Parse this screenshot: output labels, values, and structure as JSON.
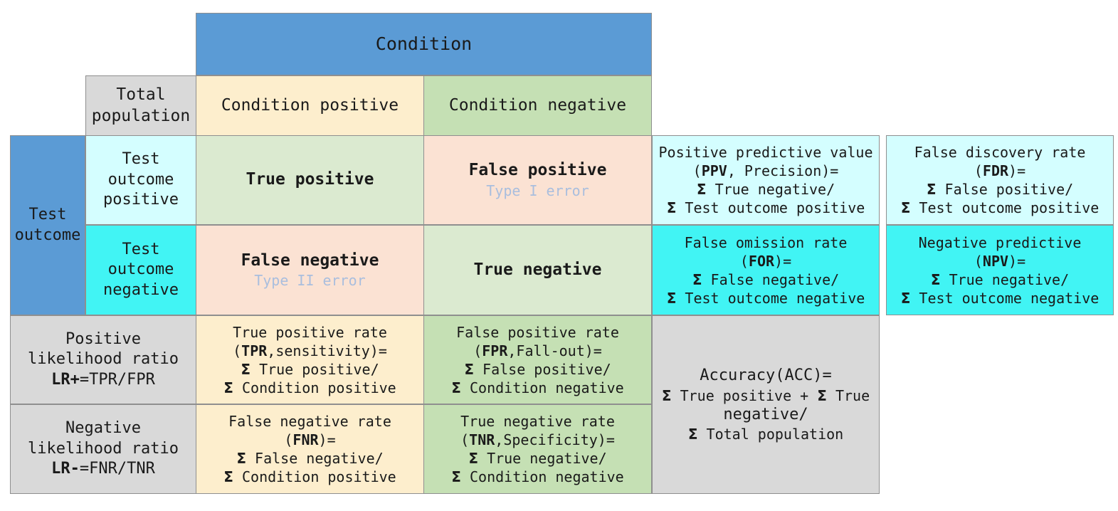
{
  "diagram": {
    "title": "Confusion matrix / diagnostic testing terminology table",
    "colors": {
      "header_blue": "#5b9bd5",
      "grey": "#d9d9d9",
      "condition_positive": "#fdeecd",
      "condition_negative": "#c5e0b4",
      "true_cell": "#dbead0",
      "false_cell": "#fbe2d3",
      "ice_light": "#d4feff",
      "cyan": "#41f4f4",
      "error_text": "#a9bede"
    }
  },
  "headers": {
    "condition": "Condition",
    "total_population": {
      "line1": "Total",
      "line2": "population"
    },
    "condition_positive": "Condition positive",
    "condition_negative": "Condition negative",
    "test_outcome": {
      "line1": "Test",
      "line2": "outcome"
    },
    "test_outcome_positive": {
      "line1": "Test",
      "line2": "outcome",
      "line3": "positive"
    },
    "test_outcome_negative": {
      "line1": "Test",
      "line2": "outcome",
      "line3": "negative"
    }
  },
  "matrix": {
    "true_positive": {
      "label": "True positive"
    },
    "false_positive": {
      "label": "False positive",
      "sub": "Type I error"
    },
    "false_negative": {
      "label": "False negative",
      "sub": "Type II error"
    },
    "true_negative": {
      "label": "True negative"
    }
  },
  "right_column_1": {
    "ppv": {
      "line1": "Positive predictive value",
      "line2_pre": "(",
      "line2_abbr": "PPV",
      "line2_post": ", Precision)=",
      "line3": "True negative/",
      "line4": "Test outcome positive"
    },
    "for": {
      "line1": "False omission rate",
      "line2_pre": "(",
      "line2_abbr": "FOR",
      "line2_post": ")=",
      "line3": "False negative/",
      "line4": "Test outcome negative"
    }
  },
  "right_column_2": {
    "fdr": {
      "line1": "False discovery rate",
      "line2_pre": "(",
      "line2_abbr": "FDR",
      "line2_post": ")=",
      "line3": "False positive/",
      "line4": "Test outcome positive"
    },
    "npv": {
      "line1": "Negative predictive",
      "line2_pre": "(",
      "line2_abbr": "NPV",
      "line2_post": ")=",
      "line3": "True negative/",
      "line4": "Test outcome negative"
    }
  },
  "likelihood": {
    "positive": {
      "line1": "Positive",
      "line2": "likelihood ratio",
      "line3_abbr": "LR+",
      "line3_post": "=TPR/FPR"
    },
    "negative": {
      "line1": "Negative",
      "line2": "likelihood ratio",
      "line3_abbr": "LR-",
      "line3_post": "=FNR/TNR"
    }
  },
  "rates": {
    "tpr": {
      "line1": "True positive rate",
      "line2_pre": "(",
      "line2_abbr": "TPR",
      "line2_post": ",sensitivity)=",
      "line3": "True positive/",
      "line4": "Condition positive"
    },
    "fpr": {
      "line1": "False positive rate",
      "line2_pre": "(",
      "line2_abbr": "FPR",
      "line2_post": ",Fall-out)=",
      "line3": "False positive/",
      "line4": "Condition negative"
    },
    "fnr": {
      "line1": "False negative rate",
      "line2_pre": "(",
      "line2_abbr": "FNR",
      "line2_post": ")=",
      "line3": "False negative/",
      "line4": "Condition positive"
    },
    "tnr": {
      "line1": "True negative rate",
      "line2_pre": "(",
      "line2_abbr": "TNR",
      "line2_post": ",Specificity)=",
      "line3": "True negative/",
      "line4": "Condition negative"
    }
  },
  "accuracy": {
    "line1": "Accuracy(ACC)=",
    "line2a": "True positive + ",
    "line2b": "True",
    "line3": "negative/",
    "line4": "Total population"
  },
  "symbols": {
    "sigma": "Σ"
  }
}
